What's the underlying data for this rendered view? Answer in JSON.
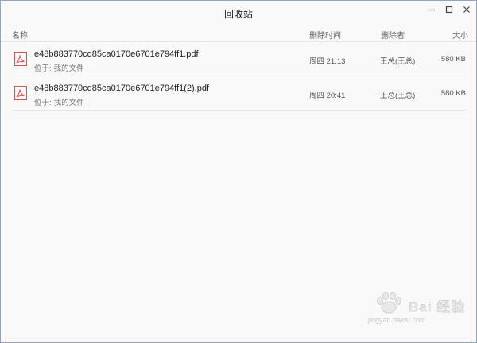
{
  "window": {
    "title": "回收站",
    "controls": {
      "minimize": "minimize-icon",
      "maximize": "maximize-icon",
      "close": "close-icon"
    }
  },
  "columns": {
    "name": "名称",
    "deleted_time": "删除时间",
    "deleted_by": "删除者",
    "size": "大小"
  },
  "files": [
    {
      "name": "e48b883770cd85ca0170e6701e794ff1.pdf",
      "location_label": "位于:",
      "location": "我的文件",
      "deleted_time": "周四 21:13",
      "deleted_by": "王总(王总)",
      "size": "580 KB",
      "icon": "pdf-icon"
    },
    {
      "name": "e48b883770cd85ca0170e6701e794ff1(2).pdf",
      "location_label": "位于:",
      "location": "我的文件",
      "deleted_time": "周四 20:41",
      "deleted_by": "王总(王总)",
      "size": "580 KB",
      "icon": "pdf-icon"
    }
  ],
  "watermark": {
    "logo_text": "Bai 经验",
    "url": "jingyan.baidu.com"
  },
  "colors": {
    "pdf_icon": "#d9534f",
    "border": "#8fa6c2"
  }
}
